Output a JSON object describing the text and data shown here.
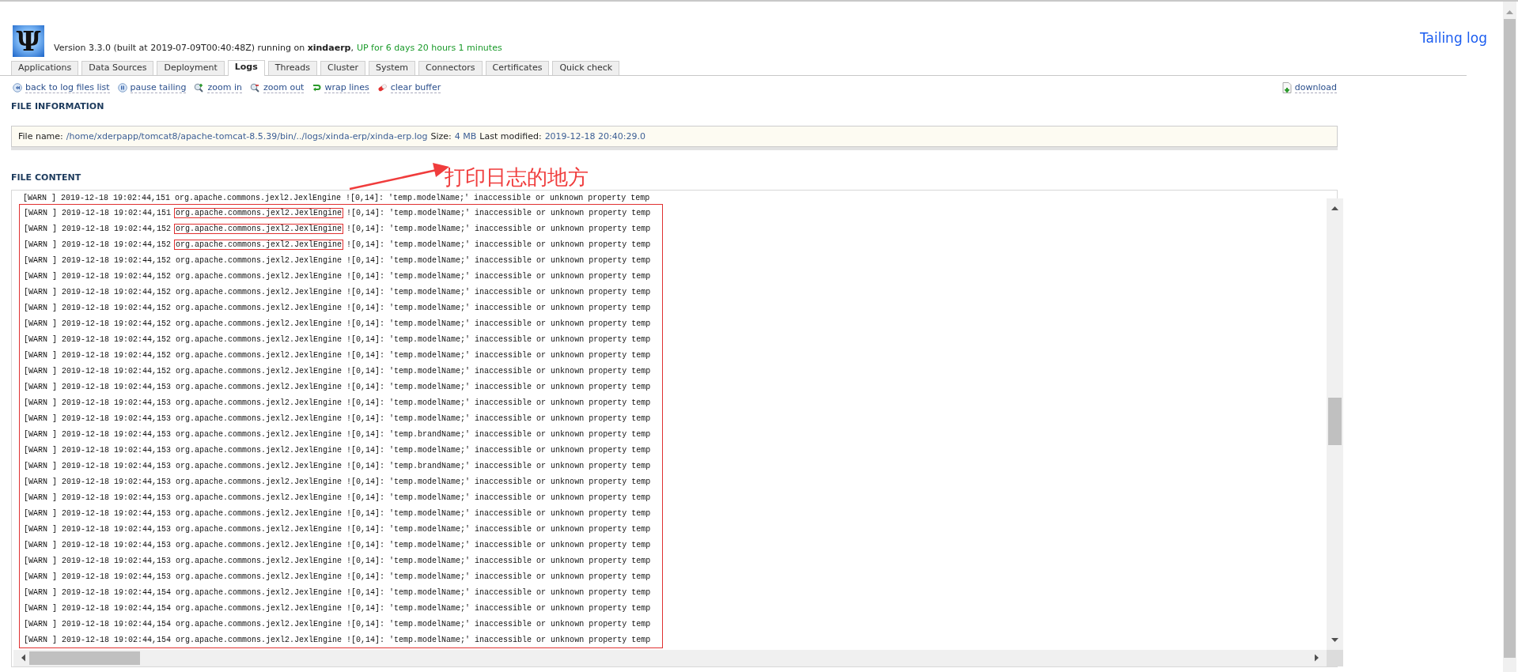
{
  "header": {
    "logo": "Ψ",
    "version_text": "Version 3.3.0 (built at 2019-07-09T00:40:48Z) running on **xindaerp**,",
    "uptime": "UP for 6 days 20 hours 1 minutes",
    "page_title": "Tailing log"
  },
  "tabs": [
    {
      "label": "Applications",
      "selected": false
    },
    {
      "label": "Data Sources",
      "selected": false
    },
    {
      "label": "Deployment",
      "selected": false
    },
    {
      "label": "Logs",
      "selected": true
    },
    {
      "label": "Threads",
      "selected": false
    },
    {
      "label": "Cluster",
      "selected": false
    },
    {
      "label": "System",
      "selected": false
    },
    {
      "label": "Connectors",
      "selected": false
    },
    {
      "label": "Certificates",
      "selected": false
    },
    {
      "label": "Quick check",
      "selected": false
    }
  ],
  "toolbar": [
    {
      "kind": "back",
      "label": "back to log files list"
    },
    {
      "kind": "pause",
      "label": "pause tailing"
    },
    {
      "kind": "zoom-in",
      "label": "zoom in"
    },
    {
      "kind": "zoom-out",
      "label": "zoom out"
    },
    {
      "kind": "wrap",
      "label": "wrap lines"
    },
    {
      "kind": "clear",
      "label": "clear buffer"
    }
  ],
  "download": {
    "label": "download"
  },
  "file_information": {
    "heading": "FILE INFORMATION",
    "fields": [
      {
        "label": "File name:",
        "value": "/home/xderpapp/tomcat8/apache-tomcat-8.5.39/bin/../logs/xinda-erp/xinda-erp.log"
      },
      {
        "label": "Size:",
        "value": "4 MB"
      },
      {
        "label": "Last modified:",
        "value": "2019-12-18 20:40:29.0"
      }
    ]
  },
  "file_content": {
    "heading": "FILE CONTENT",
    "lines": [
      {
        "prefix": "[WARN ] 2019-12-18 19:02:44,151",
        "logger": "org.apache.commons.jexl2.JexlEngine",
        "message": "![0,14]: 'temp.modelName;' inaccessible or unknown property temp",
        "highlighted": false
      },
      {
        "prefix": "[WARN ] 2019-12-18 19:02:44,151",
        "logger": "org.apache.commons.jexl2.JexlEngine",
        "message": "![0,14]: 'temp.modelName;' inaccessible or unknown property temp",
        "highlighted": true
      },
      {
        "prefix": "[WARN ] 2019-12-18 19:02:44,152",
        "logger": "org.apache.commons.jexl2.JexlEngine",
        "message": "![0,14]: 'temp.modelName;' inaccessible or unknown property temp",
        "highlighted": true
      },
      {
        "prefix": "[WARN ] 2019-12-18 19:02:44,152",
        "logger": "org.apache.commons.jexl2.JexlEngine",
        "message": "![0,14]: 'temp.modelName;' inaccessible or unknown property temp",
        "highlighted": true
      },
      {
        "prefix": "[WARN ] 2019-12-18 19:02:44,152",
        "logger": "org.apache.commons.jexl2.JexlEngine",
        "message": "![0,14]: 'temp.modelName;' inaccessible or unknown property temp",
        "highlighted": false
      },
      {
        "prefix": "[WARN ] 2019-12-18 19:02:44,152",
        "logger": "org.apache.commons.jexl2.JexlEngine",
        "message": "![0,14]: 'temp.modelName;' inaccessible or unknown property temp",
        "highlighted": false
      },
      {
        "prefix": "[WARN ] 2019-12-18 19:02:44,152",
        "logger": "org.apache.commons.jexl2.JexlEngine",
        "message": "![0,14]: 'temp.modelName;' inaccessible or unknown property temp",
        "highlighted": false
      },
      {
        "prefix": "[WARN ] 2019-12-18 19:02:44,152",
        "logger": "org.apache.commons.jexl2.JexlEngine",
        "message": "![0,14]: 'temp.modelName;' inaccessible or unknown property temp",
        "highlighted": false
      },
      {
        "prefix": "[WARN ] 2019-12-18 19:02:44,152",
        "logger": "org.apache.commons.jexl2.JexlEngine",
        "message": "![0,14]: 'temp.modelName;' inaccessible or unknown property temp",
        "highlighted": false
      },
      {
        "prefix": "[WARN ] 2019-12-18 19:02:44,152",
        "logger": "org.apache.commons.jexl2.JexlEngine",
        "message": "![0,14]: 'temp.modelName;' inaccessible or unknown property temp",
        "highlighted": false
      },
      {
        "prefix": "[WARN ] 2019-12-18 19:02:44,152",
        "logger": "org.apache.commons.jexl2.JexlEngine",
        "message": "![0,14]: 'temp.modelName;' inaccessible or unknown property temp",
        "highlighted": false
      },
      {
        "prefix": "[WARN ] 2019-12-18 19:02:44,152",
        "logger": "org.apache.commons.jexl2.JexlEngine",
        "message": "![0,14]: 'temp.modelName;' inaccessible or unknown property temp",
        "highlighted": false
      },
      {
        "prefix": "[WARN ] 2019-12-18 19:02:44,153",
        "logger": "org.apache.commons.jexl2.JexlEngine",
        "message": "![0,14]: 'temp.modelName;' inaccessible or unknown property temp",
        "highlighted": false
      },
      {
        "prefix": "[WARN ] 2019-12-18 19:02:44,153",
        "logger": "org.apache.commons.jexl2.JexlEngine",
        "message": "![0,14]: 'temp.modelName;' inaccessible or unknown property temp",
        "highlighted": false
      },
      {
        "prefix": "[WARN ] 2019-12-18 19:02:44,153",
        "logger": "org.apache.commons.jexl2.JexlEngine",
        "message": "![0,14]: 'temp.modelName;' inaccessible or unknown property temp",
        "highlighted": false
      },
      {
        "prefix": "[WARN ] 2019-12-18 19:02:44,153",
        "logger": "org.apache.commons.jexl2.JexlEngine",
        "message": "![0,14]: 'temp.brandName;' inaccessible or unknown property temp",
        "highlighted": false
      },
      {
        "prefix": "[WARN ] 2019-12-18 19:02:44,153",
        "logger": "org.apache.commons.jexl2.JexlEngine",
        "message": "![0,14]: 'temp.modelName;' inaccessible or unknown property temp",
        "highlighted": false
      },
      {
        "prefix": "[WARN ] 2019-12-18 19:02:44,153",
        "logger": "org.apache.commons.jexl2.JexlEngine",
        "message": "![0,14]: 'temp.brandName;' inaccessible or unknown property temp",
        "highlighted": false
      },
      {
        "prefix": "[WARN ] 2019-12-18 19:02:44,153",
        "logger": "org.apache.commons.jexl2.JexlEngine",
        "message": "![0,14]: 'temp.modelName;' inaccessible or unknown property temp",
        "highlighted": false
      },
      {
        "prefix": "[WARN ] 2019-12-18 19:02:44,153",
        "logger": "org.apache.commons.jexl2.JexlEngine",
        "message": "![0,14]: 'temp.modelName;' inaccessible or unknown property temp",
        "highlighted": false
      },
      {
        "prefix": "[WARN ] 2019-12-18 19:02:44,153",
        "logger": "org.apache.commons.jexl2.JexlEngine",
        "message": "![0,14]: 'temp.modelName;' inaccessible or unknown property temp",
        "highlighted": false
      },
      {
        "prefix": "[WARN ] 2019-12-18 19:02:44,153",
        "logger": "org.apache.commons.jexl2.JexlEngine",
        "message": "![0,14]: 'temp.modelName;' inaccessible or unknown property temp",
        "highlighted": false
      },
      {
        "prefix": "[WARN ] 2019-12-18 19:02:44,153",
        "logger": "org.apache.commons.jexl2.JexlEngine",
        "message": "![0,14]: 'temp.modelName;' inaccessible or unknown property temp",
        "highlighted": false
      },
      {
        "prefix": "[WARN ] 2019-12-18 19:02:44,153",
        "logger": "org.apache.commons.jexl2.JexlEngine",
        "message": "![0,14]: 'temp.modelName;' inaccessible or unknown property temp",
        "highlighted": false
      },
      {
        "prefix": "[WARN ] 2019-12-18 19:02:44,153",
        "logger": "org.apache.commons.jexl2.JexlEngine",
        "message": "![0,14]: 'temp.modelName;' inaccessible or unknown property temp",
        "highlighted": false
      },
      {
        "prefix": "[WARN ] 2019-12-18 19:02:44,154",
        "logger": "org.apache.commons.jexl2.JexlEngine",
        "message": "![0,14]: 'temp.modelName;' inaccessible or unknown property temp",
        "highlighted": false
      },
      {
        "prefix": "[WARN ] 2019-12-18 19:02:44,154",
        "logger": "org.apache.commons.jexl2.JexlEngine",
        "message": "![0,14]: 'temp.modelName;' inaccessible or unknown property temp",
        "highlighted": false
      },
      {
        "prefix": "[WARN ] 2019-12-18 19:02:44,154",
        "logger": "org.apache.commons.jexl2.JexlEngine",
        "message": "![0,14]: 'temp.modelName;' inaccessible or unknown property temp",
        "highlighted": false
      },
      {
        "prefix": "[WARN ] 2019-12-18 19:02:44,154",
        "logger": "org.apache.commons.jexl2.JexlEngine",
        "message": "![0,14]: 'temp.modelName;' inaccessible or unknown property temp",
        "highlighted": false
      }
    ]
  },
  "annotation": {
    "text": "打印日志的地方"
  }
}
